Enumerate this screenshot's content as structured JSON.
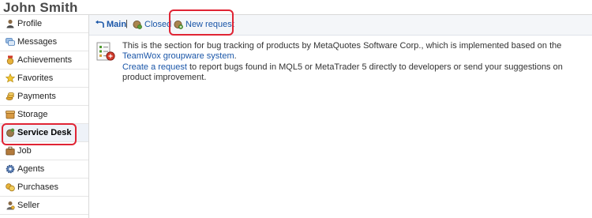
{
  "header": {
    "user_name": "John Smith"
  },
  "sidebar": {
    "items": [
      {
        "label": "Profile",
        "icon": "person-icon"
      },
      {
        "label": "Messages",
        "icon": "messages-icon"
      },
      {
        "label": "Achievements",
        "icon": "achievements-icon"
      },
      {
        "label": "Favorites",
        "icon": "star-icon"
      },
      {
        "label": "Payments",
        "icon": "coins-icon"
      },
      {
        "label": "Storage",
        "icon": "storage-icon"
      },
      {
        "label": "Service Desk",
        "icon": "service-desk-icon",
        "active": true
      },
      {
        "label": "Job",
        "icon": "job-icon"
      },
      {
        "label": "Agents",
        "icon": "gear-icon"
      },
      {
        "label": "Purchases",
        "icon": "purchases-icon"
      },
      {
        "label": "Seller",
        "icon": "seller-icon"
      }
    ]
  },
  "toolbar": {
    "main_label": "Main",
    "separator": "|",
    "closed_label": "Closed",
    "new_request_label": "New request"
  },
  "intro": {
    "line1_text": "This is the section for bug tracking of products by MetaQuotes Software Corp., which is implemented based on the",
    "line1_link": "TeamWox groupware system",
    "line1_end": ".",
    "line2_link": "Create a request",
    "line2_text": "to report bugs found in MQL5 or MetaTrader 5 directly to developers or send your suggestions on product improvement."
  },
  "colors": {
    "link": "#1a56a8",
    "highlight": "#e02434",
    "active_bg": "#eef2f8"
  }
}
